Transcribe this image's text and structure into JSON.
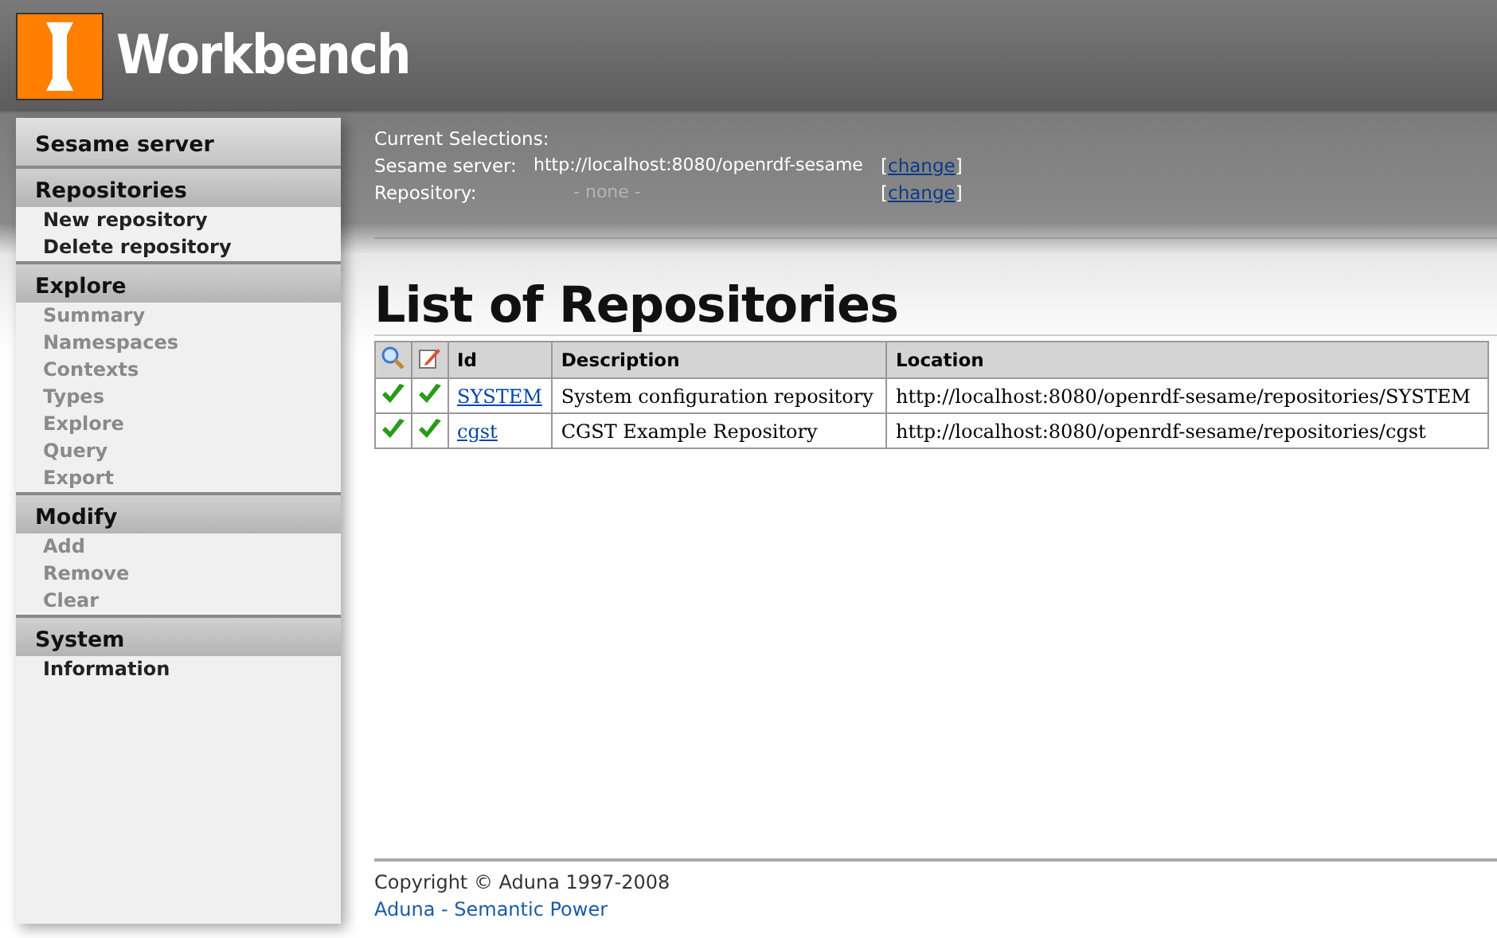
{
  "header": {
    "title": "Workbench"
  },
  "sidebar": [
    {
      "title": "Sesame server"
    },
    {
      "title": "Repositories",
      "items": [
        {
          "label": "New repository",
          "disabled": false
        },
        {
          "label": "Delete repository",
          "disabled": false
        }
      ]
    },
    {
      "title": "Explore",
      "items": [
        {
          "label": "Summary",
          "disabled": true
        },
        {
          "label": "Namespaces",
          "disabled": true
        },
        {
          "label": "Contexts",
          "disabled": true
        },
        {
          "label": "Types",
          "disabled": true
        },
        {
          "label": "Explore",
          "disabled": true
        },
        {
          "label": "Query",
          "disabled": true
        },
        {
          "label": "Export",
          "disabled": true
        }
      ]
    },
    {
      "title": "Modify",
      "items": [
        {
          "label": "Add",
          "disabled": true
        },
        {
          "label": "Remove",
          "disabled": true
        },
        {
          "label": "Clear",
          "disabled": true
        }
      ]
    },
    {
      "title": "System",
      "items": [
        {
          "label": "Information",
          "disabled": false
        }
      ]
    }
  ],
  "selections": {
    "title": "Current Selections:",
    "rows": [
      {
        "label": "Sesame server:",
        "value": "http://localhost:8080/openrdf-sesame",
        "empty": false,
        "open": "[",
        "link": "change",
        "close": "]"
      },
      {
        "label": "Repository:",
        "value": "- none -",
        "empty": true,
        "open": "[",
        "link": "change",
        "close": "]"
      }
    ]
  },
  "page_title": "List of Repositories",
  "table": {
    "columns": [
      "Id",
      "Description",
      "Location"
    ],
    "rows": [
      {
        "readable": true,
        "writable": true,
        "id": "SYSTEM",
        "description": "System configuration repository",
        "location": "http://localhost:8080/openrdf-sesame/repositories/SYSTEM"
      },
      {
        "readable": true,
        "writable": true,
        "id": "cgst",
        "description": "CGST Example Repository",
        "location": "http://localhost:8080/openrdf-sesame/repositories/cgst"
      }
    ]
  },
  "footer": {
    "copyright": "Copyright © Aduna 1997-2008",
    "link": "Aduna - Semantic Power"
  }
}
